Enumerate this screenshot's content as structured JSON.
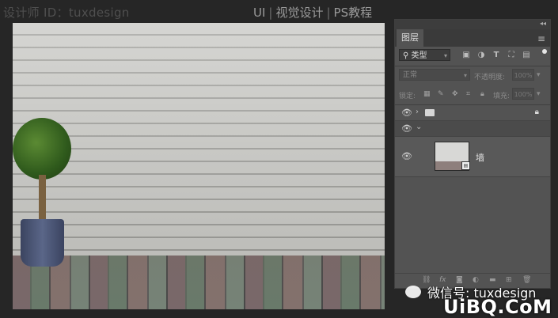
{
  "header": {
    "left": "设计师 ID：tuxdesign",
    "right_parts": [
      "UI",
      "视觉设计",
      "PS教程"
    ],
    "separator": "|"
  },
  "layers_panel": {
    "tab_label": "图层",
    "filter": {
      "kind_label": "类型",
      "icons": [
        "image-filter-icon",
        "adjust-filter-icon",
        "type-filter-icon",
        "shape-filter-icon",
        "smart-filter-icon"
      ]
    },
    "blend_mode": "正常",
    "opacity_label": "不透明度:",
    "opacity_value": "100%",
    "lock_label": "锁定:",
    "fill_label": "填充:",
    "fill_value": "100%",
    "layers": [
      {
        "type": "group",
        "collapsed": true,
        "locked": true
      },
      {
        "type": "group",
        "collapsed": false
      },
      {
        "type": "smart-object",
        "name": "墙"
      }
    ]
  },
  "watermark": {
    "line1": "微信号: tuxdesign",
    "line2": "UiBQ.CoM"
  }
}
